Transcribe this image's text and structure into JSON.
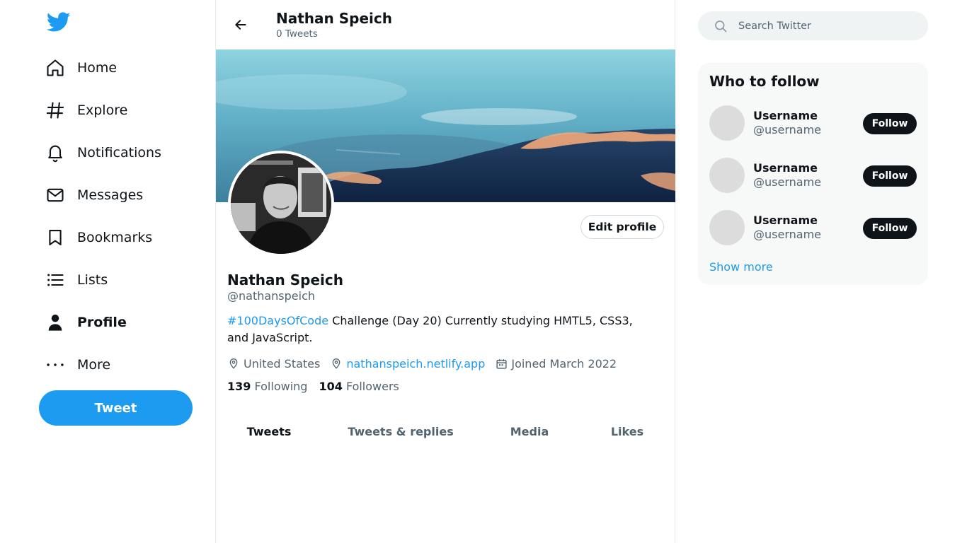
{
  "colors": {
    "accent": "#1d9bf0",
    "text": "#0f1419",
    "muted": "#536471",
    "border": "#e7e9ea"
  },
  "nav": {
    "logo": "twitter-bird-icon",
    "items": [
      {
        "label": "Home",
        "icon": "home-icon"
      },
      {
        "label": "Explore",
        "icon": "hashtag-icon"
      },
      {
        "label": "Notifications",
        "icon": "bell-icon"
      },
      {
        "label": "Messages",
        "icon": "envelope-icon"
      },
      {
        "label": "Bookmarks",
        "icon": "bookmark-icon"
      },
      {
        "label": "Lists",
        "icon": "list-icon"
      },
      {
        "label": "Profile",
        "icon": "person-icon",
        "active": true
      },
      {
        "label": "More",
        "icon": "more-dots-icon"
      }
    ],
    "tweet_button": "Tweet"
  },
  "header": {
    "name": "Nathan Speich",
    "tweet_count": "0 Tweets"
  },
  "profile": {
    "edit_button": "Edit profile",
    "name": "Nathan Speich",
    "handle": "@nathanspeich",
    "bio_hashtag": "#100DaysOfCode",
    "bio_text": " Challenge (Day 20) Currently studying HMTL5, CSS3, and JavaScript.",
    "location": "United States",
    "website": "nathanspeich.netlify.app",
    "joined": "Joined March 2022",
    "following_count": "139",
    "following_label": "Following",
    "followers_count": "104",
    "followers_label": "Followers"
  },
  "tabs": [
    "Tweets",
    "Tweets & replies",
    "Media",
    "Likes"
  ],
  "search": {
    "placeholder": "Search Twitter"
  },
  "who_to_follow": {
    "title": "Who to follow",
    "users": [
      {
        "name": "Username",
        "handle": "@username",
        "button": "Follow"
      },
      {
        "name": "Username",
        "handle": "@username",
        "button": "Follow"
      },
      {
        "name": "Username",
        "handle": "@username",
        "button": "Follow"
      }
    ],
    "show_more": "Show more"
  }
}
